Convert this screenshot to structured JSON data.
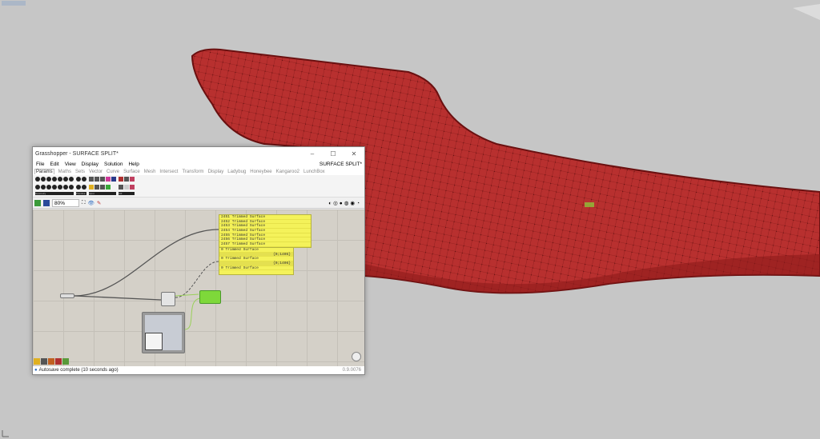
{
  "window": {
    "title": "Grasshopper - SURFACE SPLIT*",
    "document": "SURFACE SPLIT*",
    "controls": [
      "–",
      "☐",
      "✕"
    ]
  },
  "menu": [
    "File",
    "Edit",
    "View",
    "Display",
    "Solution",
    "Help"
  ],
  "tabs": [
    "Params",
    "Maths",
    "Sets",
    "Vector",
    "Curve",
    "Surface",
    "Mesh",
    "Intersect",
    "Transform",
    "Display",
    "Ladybug",
    "Honeybee",
    "Kangaroo2",
    "LunchBox"
  ],
  "ribbon_groups": [
    "Geometry",
    "Primitive",
    "Input",
    "Util"
  ],
  "toolbar": {
    "zoom": "80%"
  },
  "panel1": {
    "rows": [
      "2451 Trimmed Surface",
      "2452 Trimmed Surface",
      "2453 Trimmed Surface",
      "2454 Trimmed Surface",
      "2455 Trimmed Surface",
      "2456 Trimmed Surface",
      "2457 Trimmed Surface"
    ]
  },
  "panel2": {
    "rows": [
      "0 Trimmed Surface",
      "{0;1405}",
      "0 Trimmed Surface",
      "{0;1406}",
      "0 Trimmed Surface"
    ]
  },
  "status": {
    "message": "Autosave complete (10 seconds ago)",
    "version": "0.9.0076"
  },
  "colors": {
    "surface": "#b3282a",
    "panel": "#f4f25a",
    "component": "#7ed83a"
  }
}
